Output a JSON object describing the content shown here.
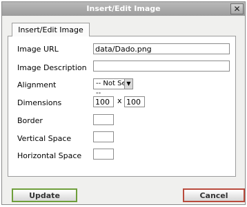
{
  "dialog": {
    "title": "Insert/Edit Image",
    "close_label": "✕",
    "tab_label": "Insert/Edit Image"
  },
  "form": {
    "image_url_label": "Image URL",
    "image_url_value": "data/Dado.png",
    "image_description_label": "Image Description",
    "image_description_value": "",
    "alignment_label": "Alignment",
    "alignment_selected": "-- Not Set --",
    "dimensions_label": "Dimensions",
    "width_value": "100",
    "dimension_separator": "x",
    "height_value": "100",
    "border_label": "Border",
    "border_value": "",
    "vertical_space_label": "Vertical Space",
    "vertical_space_value": "",
    "horizontal_space_label": "Horizontal Space",
    "horizontal_space_value": ""
  },
  "buttons": {
    "update_label": "Update",
    "cancel_label": "Cancel"
  },
  "icons": {
    "close": "close-icon",
    "dropdown": "chevron-down-icon"
  }
}
